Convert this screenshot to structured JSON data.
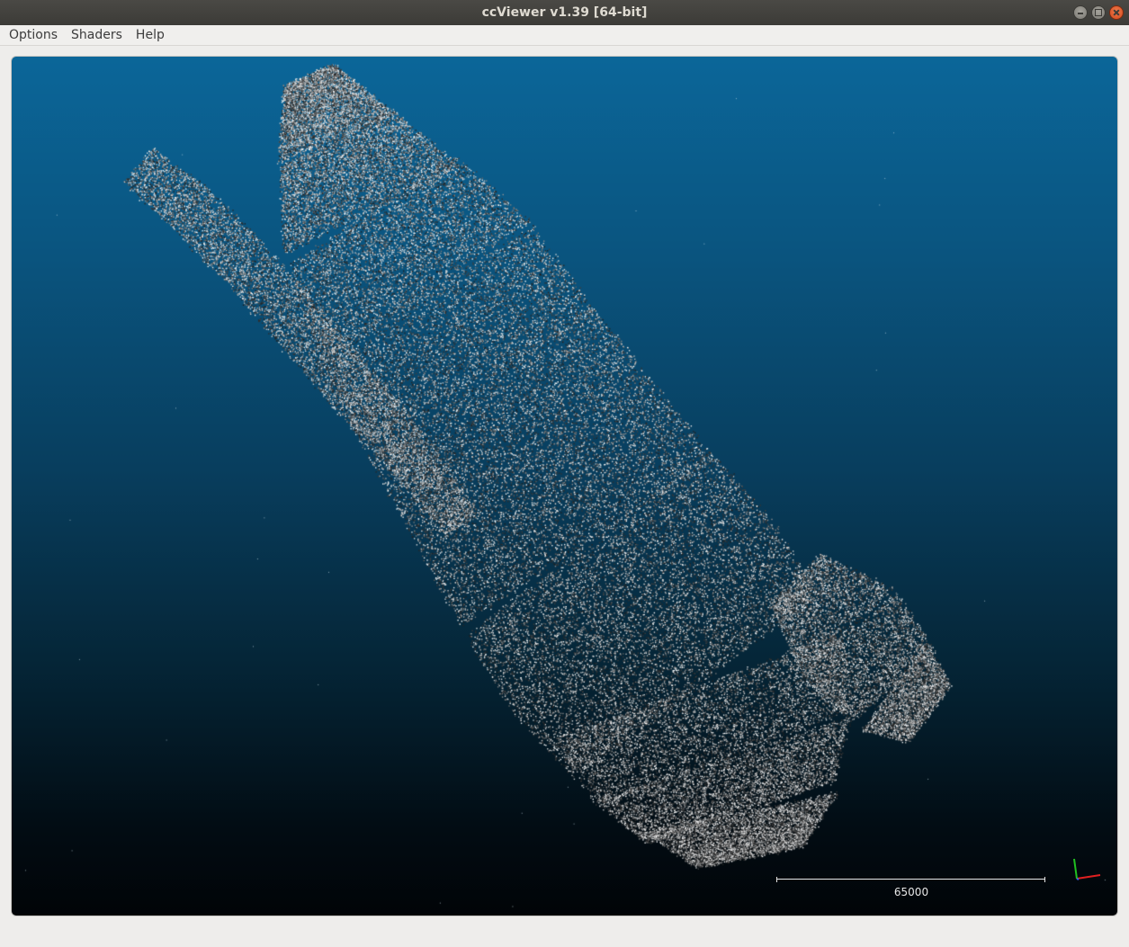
{
  "window": {
    "title": "ccViewer v1.39 [64-bit]",
    "controls": [
      "minimize-icon",
      "maximize-icon",
      "close-icon"
    ]
  },
  "menu": {
    "items": [
      {
        "label": "Options"
      },
      {
        "label": "Shaders"
      },
      {
        "label": "Help"
      }
    ]
  },
  "viewport": {
    "background_top": "#0b6699",
    "background_bottom": "#010407",
    "scale_label": "65000",
    "axis_colors": {
      "x": "#e02020",
      "y": "#20c020",
      "z": "#3060ff"
    }
  }
}
